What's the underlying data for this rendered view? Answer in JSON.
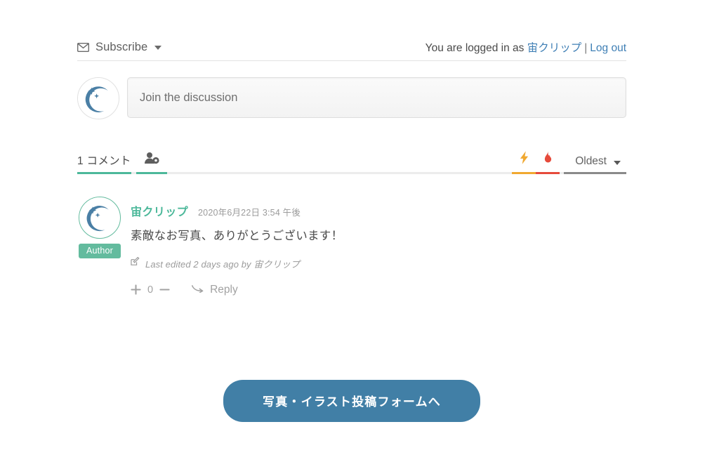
{
  "header": {
    "subscribe_label": "Subscribe",
    "subscribe_icon": "envelope-icon",
    "subscribe_caret_icon": "chevron-down-icon",
    "logged_in_prefix": "You are logged in as",
    "user_name": "宙クリップ",
    "separator": "|",
    "logout_label": "Log out"
  },
  "compose": {
    "avatar_icon": "moon-paperclip-avatar",
    "placeholder": "Join the discussion"
  },
  "tabbar": {
    "comments_tab_label": "1 コメント",
    "users_tab_icon": "user-settings-icon",
    "bolt_tab_icon": "lightning-bolt-icon",
    "flame_tab_icon": "flame-icon",
    "sort_label": "Oldest",
    "sort_caret_icon": "chevron-down-icon"
  },
  "comment": {
    "avatar_icon": "moon-paperclip-avatar",
    "author_badge": "Author",
    "author_name": "宙クリップ",
    "timestamp": "2020年6月22日 3:54 午後",
    "text": "素敵なお写真、ありがとうございます！",
    "edited_icon": "edit-pencil-icon",
    "edited_text": "Last edited 2 days ago by 宙クリップ",
    "vote_up_icon": "plus-icon",
    "vote_count": "0",
    "vote_down_icon": "minus-icon",
    "reply_icon": "reply-arrow-icon",
    "reply_label": "Reply"
  },
  "cta": {
    "label": "写真・イラスト投稿フォームへ"
  },
  "colors": {
    "accent_green": "#4cb89a",
    "badge_green": "#63bb9e",
    "link_blue": "#3f7fb5",
    "cta_blue": "#417fa6",
    "bolt_orange": "#f0a830",
    "flame_red": "#e64a3b",
    "avatar_blue": "#4a7fa5",
    "muted_gray": "#9b9b9b"
  }
}
